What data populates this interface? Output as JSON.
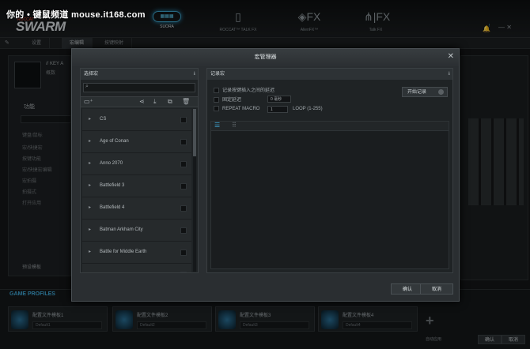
{
  "watermark": "你的 • 键鼠频道 mouse.it168.com",
  "app": {
    "brand": "SWARM",
    "brand_sub": "ROCCAT"
  },
  "nav": [
    {
      "label": "SUORA",
      "icon": "keyboard-icon",
      "active": true
    },
    {
      "label": "ROCCAT™ TALK FX",
      "icon": "phone-icon"
    },
    {
      "label": "AlienFX™",
      "icon": "alienfx-icon"
    },
    {
      "label": "Talk FX",
      "icon": "share-icon"
    }
  ],
  "notif": "!",
  "subtabs": [
    "设置",
    "宏编辑",
    "按键映射"
  ],
  "bg": {
    "key_title": "// KEY A",
    "key_sub": "概数",
    "section": "功能",
    "items": [
      "键盘/鼠标",
      "宏/快捷宏",
      "按键功能",
      "宏/快捷宏编辑",
      "宏拍摄",
      "拍摄式",
      "打开应用"
    ],
    "bottom_btn": "预设模板"
  },
  "dialog": {
    "title": "宏管理器",
    "close": "✕",
    "left": {
      "header": "选择宏",
      "search_placeholder": "",
      "items": [
        "CS",
        "Age of Conan",
        "Anno 2070",
        "Battlefield 3",
        "Battlefield 4",
        "Batman Arkham City",
        "Battle for Middle Earth",
        "..."
      ]
    },
    "right": {
      "header": "记录宏",
      "opt1": "记录按键插入之间的延迟",
      "opt2": "固定延迟",
      "opt2_val": "0 毫秒",
      "opt3": "REPEAT MACRO",
      "opt3_val": "1",
      "opt3_suffix": "LOOP (1-255)",
      "record": "开始记录"
    },
    "ok": "确认",
    "cancel": "取消"
  },
  "profiles": {
    "title": "GAME PROFILES",
    "items": [
      {
        "name": "配置文件模板1",
        "default": "Default1"
      },
      {
        "name": "配置文件模板2",
        "default": "Default2"
      },
      {
        "name": "配置文件模板3",
        "default": "Default3"
      },
      {
        "name": "配置文件模板4",
        "default": "Default4"
      }
    ],
    "add": "+"
  },
  "footer": {
    "autoapply": "自动应用",
    "ok": "确认",
    "cancel": "取消"
  }
}
